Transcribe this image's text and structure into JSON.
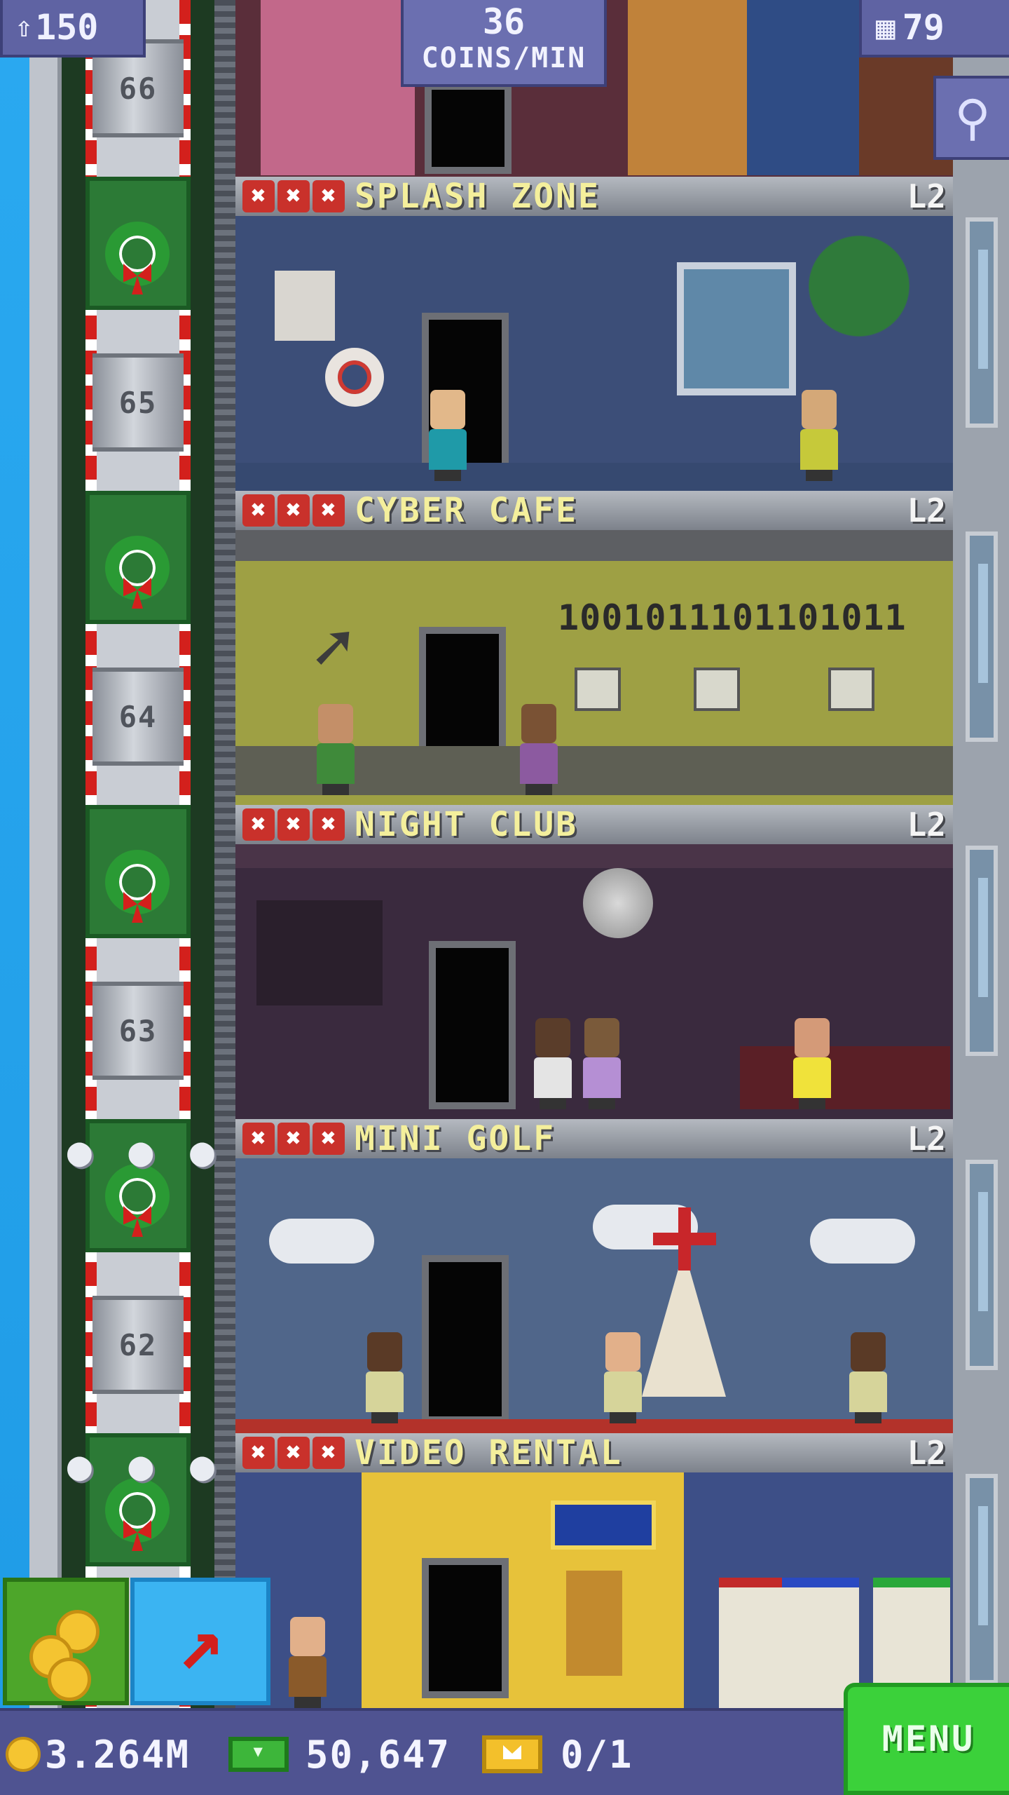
{
  "top_hud": {
    "population": "150",
    "coins_rate_value": "36",
    "coins_rate_unit": "COINS/MIN",
    "floors": "79"
  },
  "elevator": {
    "floor_numbers": [
      "66",
      "65",
      "64",
      "63",
      "62"
    ]
  },
  "floors": [
    {
      "name": "SPLASH ZONE",
      "level": "L2",
      "rating_marks": [
        "✖",
        "✖",
        "✖"
      ],
      "wall_color": "#3c4e78"
    },
    {
      "name": "CYBER CAFE",
      "level": "L2",
      "rating_marks": [
        "✖",
        "✖",
        "✖"
      ],
      "wall_color": "#9ea044",
      "screen_text": "1001011101101011"
    },
    {
      "name": "NIGHT CLUB",
      "level": "L2",
      "rating_marks": [
        "✖",
        "✖",
        "✖"
      ],
      "wall_color": "#3a2a3e"
    },
    {
      "name": "MINI GOLF",
      "level": "L2",
      "rating_marks": [
        "✖",
        "✖",
        "✖"
      ],
      "wall_color": "#50668a"
    },
    {
      "name": "VIDEO RENTAL",
      "level": "L2",
      "rating_marks": [
        "✖",
        "✖",
        "✖"
      ],
      "wall_color": "#3d4f87"
    }
  ],
  "bottom_bar": {
    "coins": "3.264M",
    "bux": "50,647",
    "tickets": "0/1",
    "menu_label": "MENU"
  },
  "icons": {
    "population": "person-up-icon",
    "floors": "building-icon",
    "search": "magnifier-icon",
    "coins_button": "coins-icon",
    "elevator_button": "arrow-up-icon"
  },
  "colors": {
    "hud_bg": "#5f63a3",
    "menu_green": "#3bd13a",
    "floor_title": "#f4ef9c",
    "candy_red": "#d3201c"
  }
}
